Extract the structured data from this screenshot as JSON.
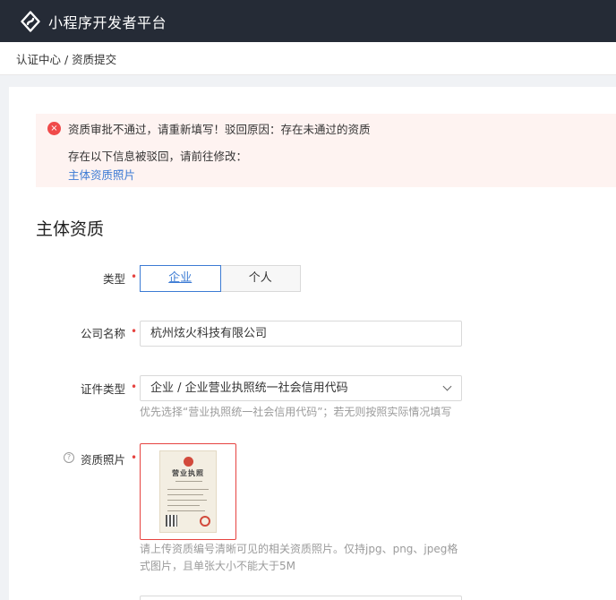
{
  "header": {
    "app_title": "小程序开发者平台"
  },
  "breadcrumb": {
    "text": "认证中心 / 资质提交"
  },
  "alert": {
    "icon": "close-circle-icon",
    "title": "资质审批不通过，请重新填写！驳回原因：存在未通过的资质",
    "subtitle": "存在以下信息被驳回，请前往修改：",
    "link": "主体资质照片"
  },
  "section": {
    "title": "主体资质"
  },
  "form": {
    "type": {
      "label": "类型",
      "options": [
        "企业",
        "个人"
      ],
      "selected": "企业"
    },
    "company": {
      "label": "公司名称",
      "value": "杭州炫火科技有限公司"
    },
    "cert_type": {
      "label": "证件类型",
      "value": "企业 / 企业营业执照统一社会信用代码",
      "hint": "优先选择“营业执照统一社会信用代码”；若无则按照实际情况填写"
    },
    "photo": {
      "label": "资质照片",
      "doc_heading": "营业执照",
      "hint_line1": "请上传资质编号清晰可见的相关资质照片。仅持jpg、png、jpeg格",
      "hint_line2": "式图片，且单张大小不能大于5M"
    },
    "required_mark": "•"
  },
  "colors": {
    "topbar": "#252b36",
    "accent": "#3c7bd4",
    "error": "#e64340",
    "alert_bg": "#fef3f1"
  }
}
